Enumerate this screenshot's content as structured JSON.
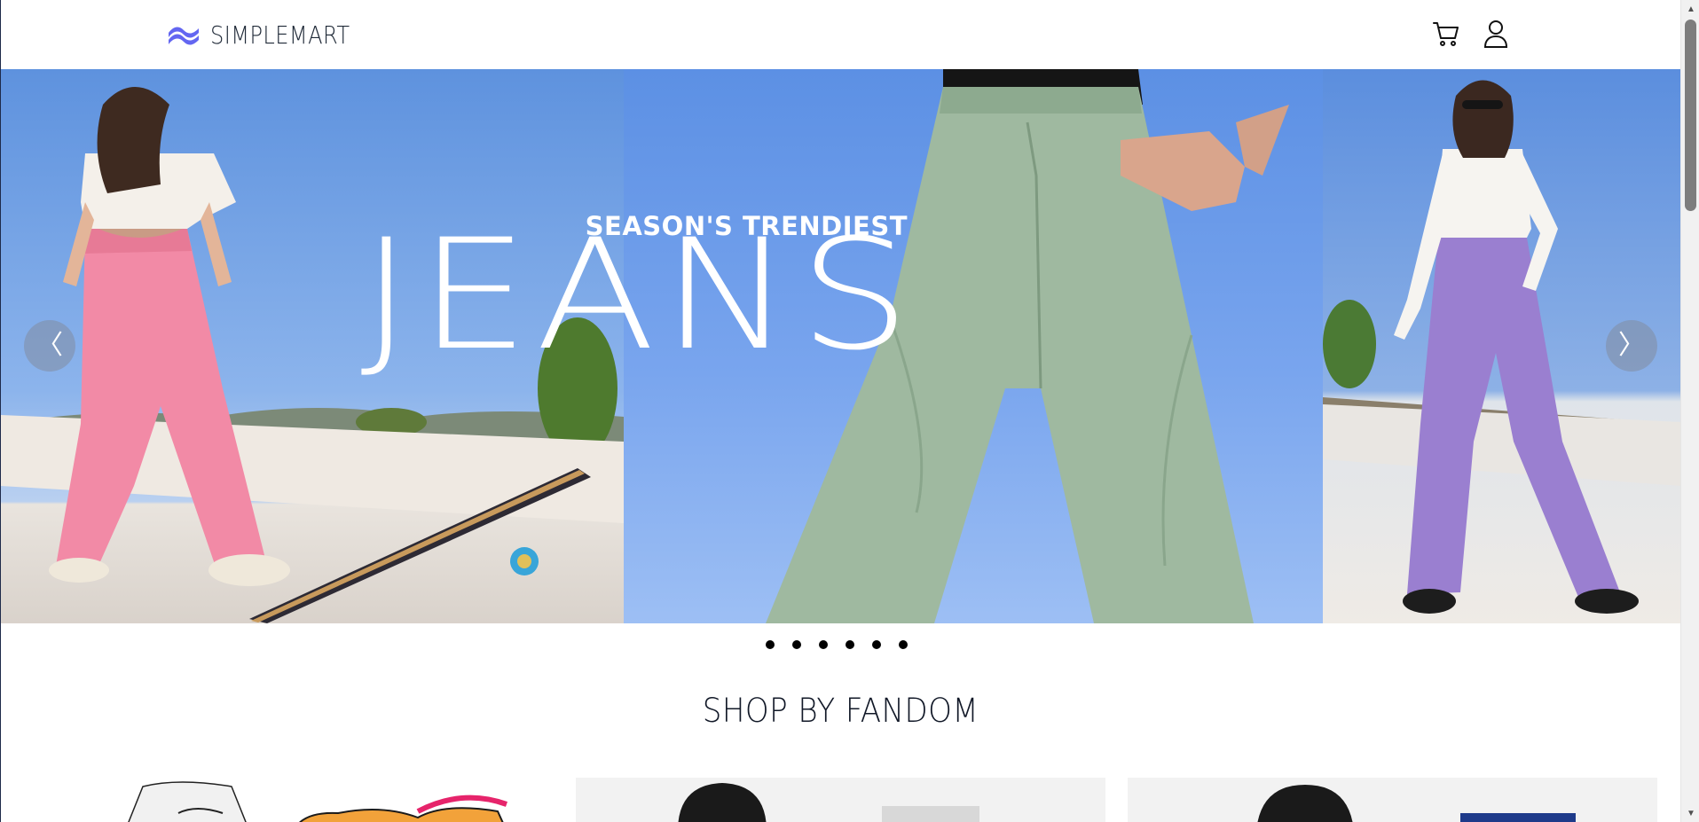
{
  "brand": {
    "name": "SIMPLEMART",
    "logo_icon": "wave-logo-icon",
    "accent": "#6366f1"
  },
  "header": {
    "cart_icon": "cart-icon",
    "account_icon": "user-icon"
  },
  "hero": {
    "kicker": "SEASON'S TRENDIEST",
    "title": "JEANS",
    "prev_glyph": "〈",
    "next_glyph": "〉",
    "slide_count": 6
  },
  "section": {
    "title": "SHOP BY FANDOM"
  },
  "scrollbar": {
    "up_glyph": "▲",
    "down_glyph": "▼"
  }
}
